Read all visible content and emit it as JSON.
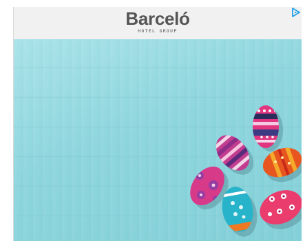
{
  "ad": {
    "brand_name": "Barceló",
    "brand_tagline": "HOTEL GROUP",
    "image_subject": "easter-eggs",
    "colors": {
      "header_bg": "#f1f1f1",
      "brand_text": "#555555",
      "background_wood": "#8fd6de",
      "adchoices": "#1fa1e6"
    }
  },
  "icons": {
    "adchoices": "adchoices-icon"
  }
}
